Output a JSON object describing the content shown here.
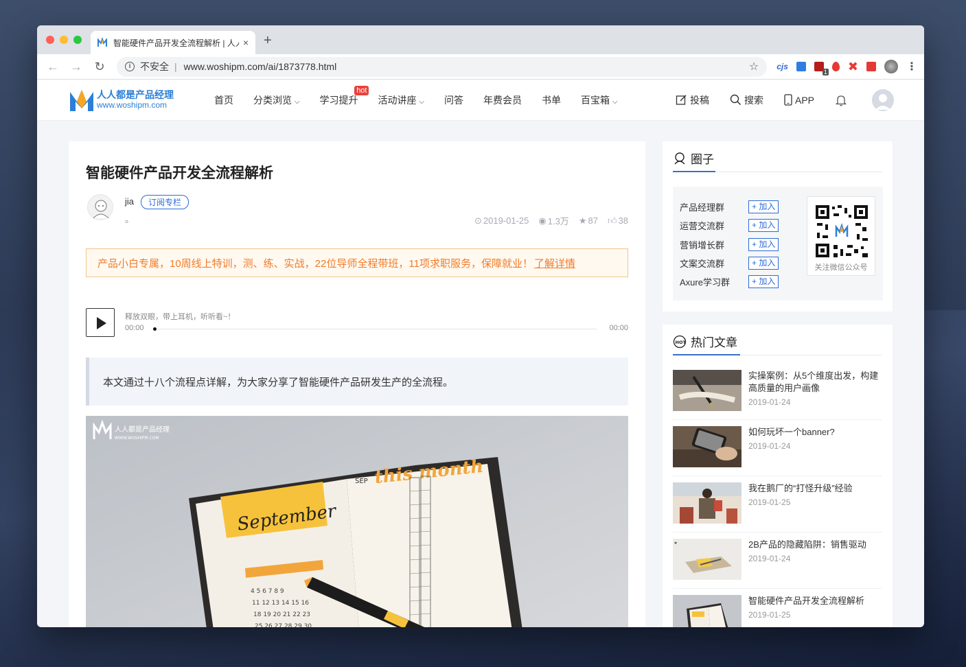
{
  "browser": {
    "tab_title": "智能硬件产品开发全流程解析 | 人人都是产品经理",
    "tab_close": "×",
    "new_tab": "+",
    "insecure_label": "不安全",
    "url": "www.woshipm.com/ai/1873778.html",
    "ext_cjs": "cjs",
    "ext_badge": "1"
  },
  "site": {
    "logo_cn": "人人都是产品经理",
    "logo_en": "www.woshipm.com",
    "nav": [
      {
        "label": "首页"
      },
      {
        "label": "分类浏览"
      },
      {
        "label": "学习提升",
        "badge": "hot"
      },
      {
        "label": "活动讲座"
      },
      {
        "label": "问答"
      },
      {
        "label": "年费会员"
      },
      {
        "label": "书单"
      },
      {
        "label": "百宝箱"
      }
    ],
    "right": {
      "contribute": "投稿",
      "search": "搜索",
      "app": "APP"
    }
  },
  "article": {
    "title": "智能硬件产品开发全流程解析",
    "author": "jia",
    "subscribe": "订阅专栏",
    "bio": "。",
    "date": "2019-01-25",
    "views": "1.3万",
    "stars": "87",
    "likes": "38",
    "promo": "产品小白专属，10周线上特训，测、练、实战，22位导师全程带班，11项求职服务，保障就业！",
    "promo_link": "了解详情",
    "audio_hint": "释放双眼，带上耳机，听听看~！",
    "audio_current": "00:00",
    "audio_total": "00:00",
    "summary": "本文通过十八个流程点详解，为大家分享了智能硬件产品研发生产的全流程。",
    "hero_watermark_cn": "人人都是产品经理",
    "hero_watermark_en": "WWW.WOSHIPM.COM",
    "hero_text_month": "this month",
    "hero_text_sep": "SEP",
    "hero_text_september": "September"
  },
  "sidebar": {
    "circle_title": "圈子",
    "join_label": "+ 加入",
    "groups": [
      "产品经理群",
      "运营交流群",
      "营销增长群",
      "文案交流群",
      "Axure学习群"
    ],
    "qr_label": "关注微信公众号",
    "hot_title": "热门文章",
    "hot_articles": [
      {
        "title": "实操案例：从5个维度出发，构建高质量的用户画像",
        "date": "2019-01-24"
      },
      {
        "title": "如何玩坏一个banner?",
        "date": "2019-01-24"
      },
      {
        "title": "我在鹅厂的“打怪升级”经验",
        "date": "2019-01-25"
      },
      {
        "title": "2B产品的隐藏陷阱：销售驱动",
        "date": "2019-01-24"
      },
      {
        "title": "智能硬件产品开发全流程解析",
        "date": "2019-01-25"
      }
    ]
  },
  "colors": {
    "accent": "#2b6bd6",
    "promo": "#f07c2a",
    "hot_badge": "#e8423a"
  }
}
